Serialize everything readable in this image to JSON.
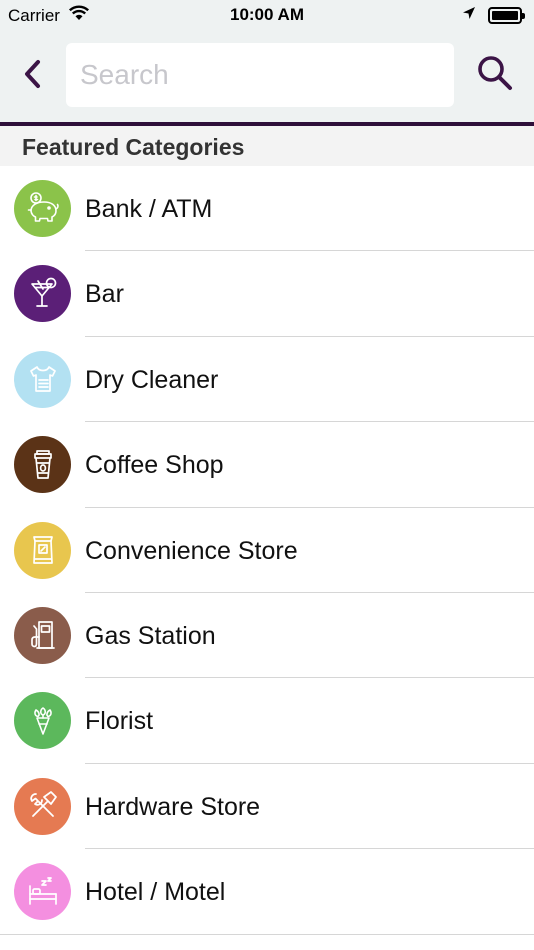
{
  "status_bar": {
    "carrier": "Carrier",
    "time": "10:00 AM",
    "icons": [
      "wifi-icon",
      "location-arrow-icon",
      "battery-icon"
    ]
  },
  "nav": {
    "back_icon": "chevron-left-icon",
    "search_placeholder": "Search",
    "search_value": "",
    "search_icon": "magnifier-icon",
    "accent_color": "#3b1446"
  },
  "section": {
    "title": "Featured Categories"
  },
  "categories": [
    {
      "label": "Bank / ATM",
      "icon": "piggy-bank-icon",
      "color": "#8bc34a"
    },
    {
      "label": "Bar",
      "icon": "cocktail-icon",
      "color": "#5b1f77"
    },
    {
      "label": "Dry Cleaner",
      "icon": "shirt-icon",
      "color": "#b3e1f2"
    },
    {
      "label": "Coffee Shop",
      "icon": "coffee-cup-icon",
      "color": "#5b3317"
    },
    {
      "label": "Convenience Store",
      "icon": "snack-bag-icon",
      "color": "#e8c64e"
    },
    {
      "label": "Gas Station",
      "icon": "fuel-pump-icon",
      "color": "#8a5c4b"
    },
    {
      "label": "Florist",
      "icon": "bouquet-icon",
      "color": "#5cb85c"
    },
    {
      "label": "Hardware Store",
      "icon": "tools-icon",
      "color": "#e57a52"
    },
    {
      "label": "Hotel / Motel",
      "icon": "bed-icon",
      "color": "#f48fe0"
    }
  ]
}
